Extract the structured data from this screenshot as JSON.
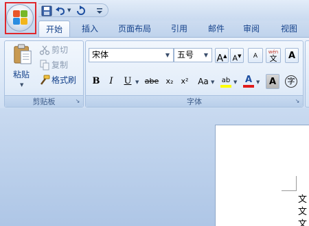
{
  "tabs": [
    {
      "label": "开始"
    },
    {
      "label": "插入"
    },
    {
      "label": "页面布局"
    },
    {
      "label": "引用"
    },
    {
      "label": "邮件"
    },
    {
      "label": "审阅"
    },
    {
      "label": "视图"
    }
  ],
  "clipboard": {
    "paste_label": "粘贴",
    "cut_label": "剪切",
    "copy_label": "复制",
    "format_painter_label": "格式刷",
    "group_label": "剪贴板"
  },
  "font": {
    "font_name": "宋体",
    "font_size": "五号",
    "phonetic_glyph": "wén",
    "phonetic_char": "文",
    "clear_format_glyph": "A",
    "group_label": "字体",
    "bold": "B",
    "italic": "I",
    "underline": "U",
    "strike": "abe",
    "subscript": "x₂",
    "superscript": "x²",
    "change_case": "Aa",
    "font_color": "A",
    "char_shading": "A",
    "enclose_char": "字",
    "grow_font": "A",
    "shrink_font": "A",
    "highlight": "ab"
  },
  "document": {
    "lines": [
      "文",
      "文",
      "文"
    ]
  },
  "colors": {
    "highlight_box": "#e0262b",
    "font_color_bar": "#e01b1b",
    "highlight_bar": "#ffff00"
  },
  "icons": [
    "office-logo-icon",
    "save-icon",
    "undo-icon",
    "redo-icon",
    "qat-customize-icon",
    "paste-icon",
    "scissors-icon",
    "copy-icon",
    "format-painter-icon",
    "dialog-launcher-icon"
  ]
}
